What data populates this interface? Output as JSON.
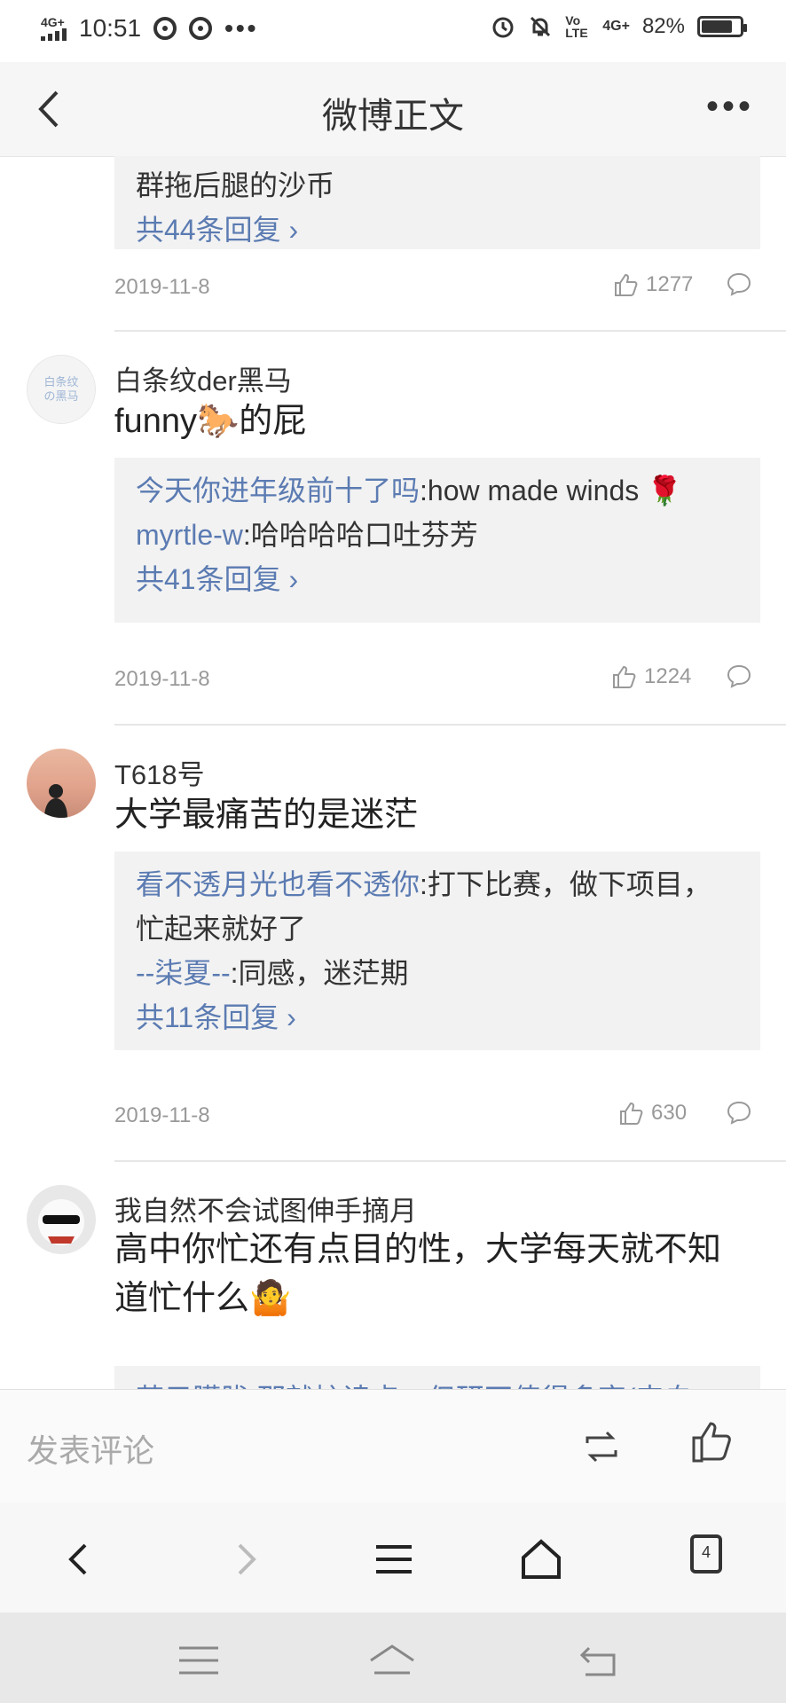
{
  "status_bar": {
    "network_left": "4G+",
    "time": "10:51",
    "network_right": "4G+",
    "volte": "Vo LTE",
    "battery": "82%",
    "battery_fraction": 0.82
  },
  "header": {
    "title": "微博正文"
  },
  "comments": [
    {
      "reply_box": {
        "partial_text": "群拖后腿的沙币",
        "more": "共44条回复 ›"
      },
      "date": "2019-11-8",
      "likes": "1277"
    },
    {
      "username": "白条纹der黑马",
      "avatar_text": "白条纹の黑马",
      "text": "funny🐎的屁",
      "replies": [
        {
          "name": "今天你进年级前十了吗",
          "text": ":how made winds 🌹"
        },
        {
          "name": "myrtle-w",
          "text": ":哈哈哈哈口吐芬芳"
        }
      ],
      "more": "共41条回复 ›",
      "date": "2019-11-8",
      "likes": "1224"
    },
    {
      "username": "T618号",
      "text": "大学最痛苦的是迷茫",
      "replies": [
        {
          "name": "看不透月光也看不透你",
          "text": ":打下比赛，做下项目，忙起来就好了"
        },
        {
          "name": "--柒夏--",
          "text": ":同感，迷茫期"
        }
      ],
      "more": "共11条回复 ›",
      "date": "2019-11-8",
      "likes": "630"
    },
    {
      "username": "我自然不会试图伸手摘月",
      "text": "高中你忙还有点目的性，大学每天就不知道忙什么🤷",
      "reply_partial": "若元朦胧:那就忙读点，但研不值得多变(来自"
    }
  ],
  "comment_bar": {
    "placeholder": "发表评论"
  },
  "browser_nav": {
    "tab_count": "4"
  }
}
